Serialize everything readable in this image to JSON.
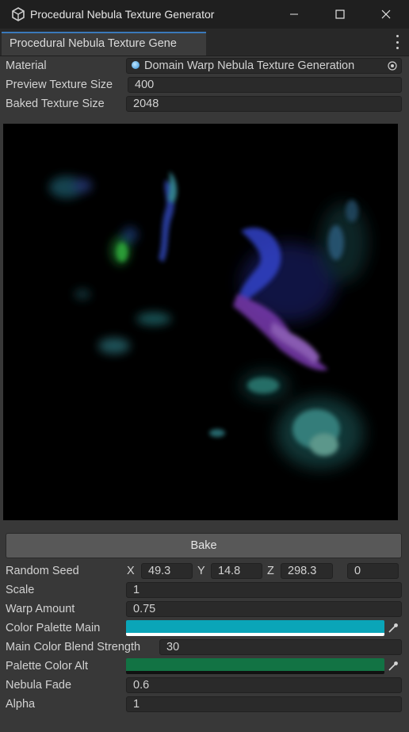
{
  "window": {
    "title": "Procedural Nebula Texture Generator",
    "tab_label": "Procedural Nebula Texture Gene"
  },
  "fields": {
    "material_label": "Material",
    "material_value": "Domain Warp Nebula Texture Generation",
    "preview_size_label": "Preview Texture Size",
    "preview_size_value": "400",
    "baked_size_label": "Baked Texture Size",
    "baked_size_value": "2048"
  },
  "bake_label": "Bake",
  "params": {
    "seed_label": "Random Seed",
    "seed_x_label": "X",
    "seed_x": "49.3",
    "seed_y_label": "Y",
    "seed_y": "14.8",
    "seed_z_label": "Z",
    "seed_z": "298.3",
    "seed_w": "0",
    "scale_label": "Scale",
    "scale_value": "1",
    "warp_label": "Warp Amount",
    "warp_value": "0.75",
    "palette_main_label": "Color Palette Main",
    "palette_main_color": "#0aa5b8",
    "blend_label": "Main Color Blend Strength",
    "blend_value": "30",
    "palette_alt_label": "Palette Color Alt",
    "palette_alt_color": "#127344",
    "fade_label": "Nebula Fade",
    "fade_value": "0.6",
    "alpha_label": "Alpha",
    "alpha_value": "1"
  },
  "icons": {
    "app": "unity-cube-icon",
    "minimize": "minimize-icon",
    "maximize": "maximize-icon",
    "close": "close-icon",
    "menu": "kebab-menu-icon",
    "object_picker": "object-picker-icon",
    "eyedropper": "eyedropper-icon"
  }
}
